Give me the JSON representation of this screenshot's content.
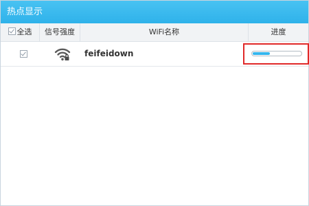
{
  "window": {
    "title": "热点显示"
  },
  "table": {
    "columns": {
      "select_all": "全选",
      "signal": "信号强度",
      "wifi_name": "WiFi名称",
      "progress": "进度"
    },
    "rows": [
      {
        "checked": true,
        "signal_icon": "wifi-locked-icon",
        "ssid": "feifeidown",
        "progress": 0.35
      }
    ]
  },
  "colors": {
    "titlebar": "#3ab8ee",
    "progress_fill": "#34b6ee",
    "highlight_box": "#e02828"
  }
}
